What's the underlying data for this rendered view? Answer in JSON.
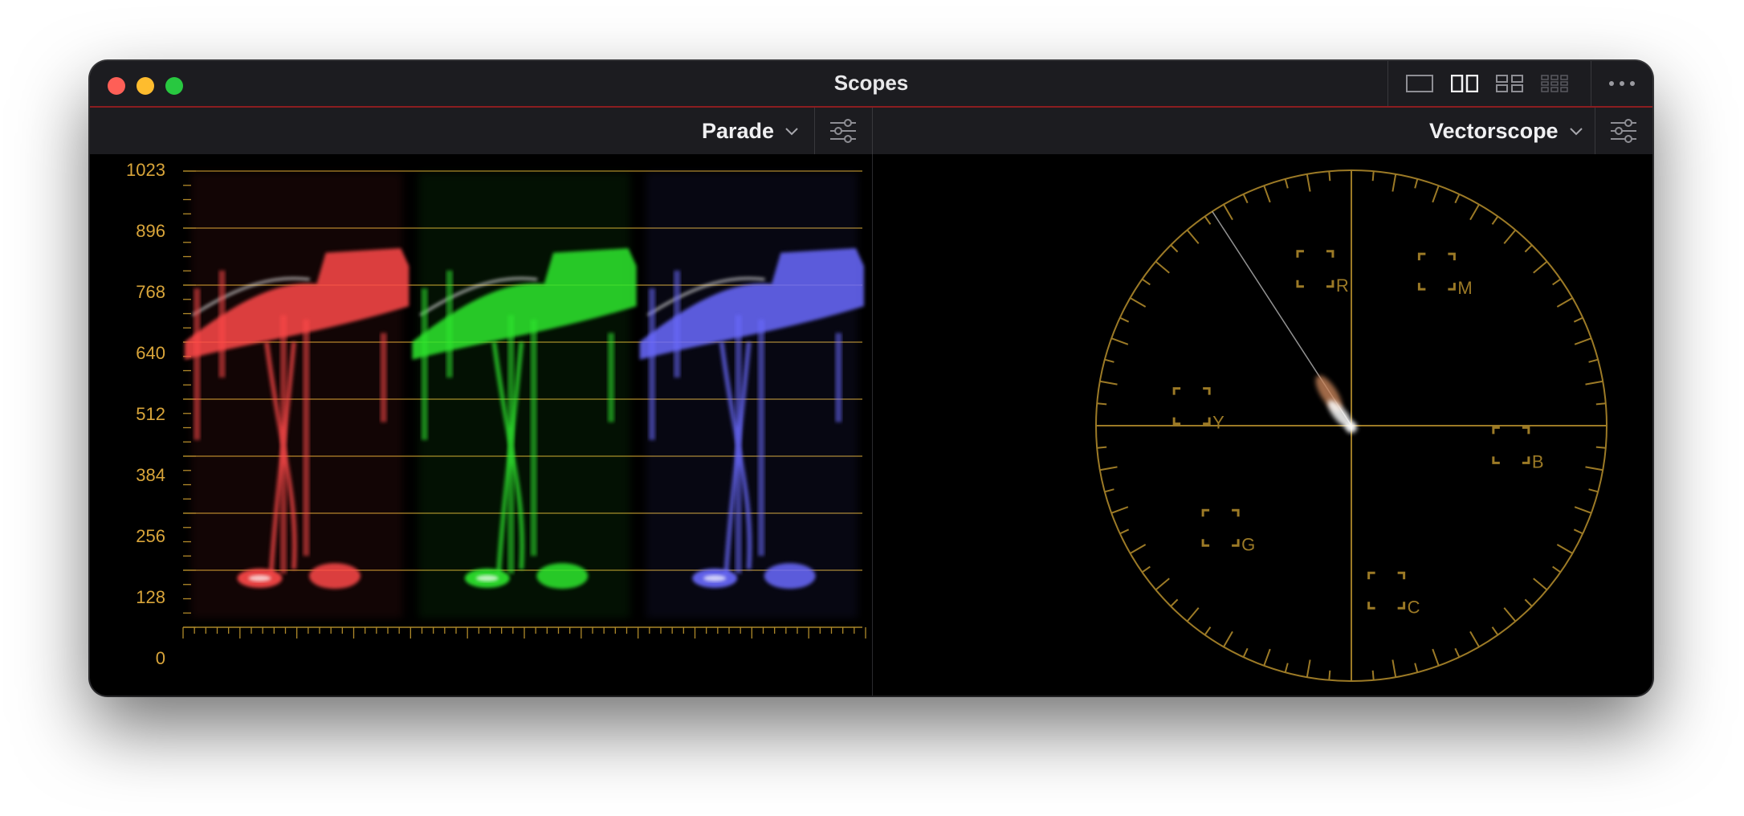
{
  "window": {
    "title": "Scopes"
  },
  "toolbar": {
    "layout_icons": [
      "single-layout-icon",
      "dual-layout-icon",
      "quad-layout-icon",
      "grid-layout-icon"
    ],
    "more_icon": "more-icon"
  },
  "left_panel": {
    "scope_label": "Parade",
    "settings_icon": "sliders-icon",
    "y_ticks": [
      "1023",
      "896",
      "768",
      "640",
      "512",
      "384",
      "256",
      "128",
      "0"
    ]
  },
  "right_panel": {
    "scope_label": "Vectorscope",
    "settings_icon": "sliders-icon",
    "targets": [
      "R",
      "M",
      "Y",
      "B",
      "G",
      "C"
    ]
  },
  "colors": {
    "accent": "#d9a53a",
    "title_border": "#8b1d20",
    "red_channel": "#ff4a4a",
    "green_channel": "#2ee82e",
    "blue_channel": "#6b6bff"
  }
}
